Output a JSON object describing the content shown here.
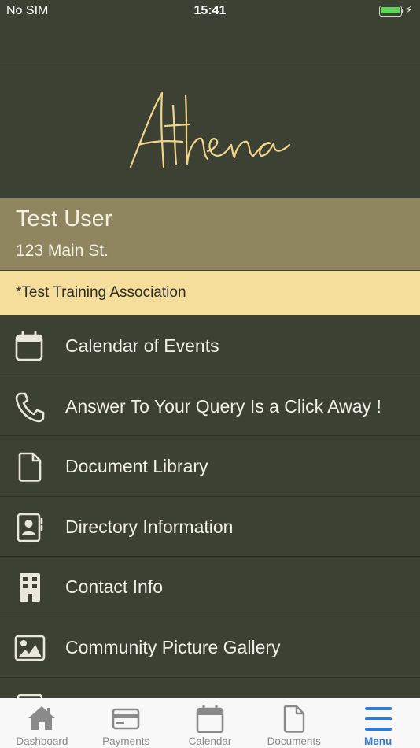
{
  "status_bar": {
    "carrier": "No SIM",
    "time": "15:41"
  },
  "brand": {
    "logo_text": "Athena",
    "logo_color": "#f0d58a"
  },
  "profile": {
    "name": "Test User",
    "address": "123 Main St."
  },
  "association": {
    "name": "*Test Training Association"
  },
  "menu": {
    "items": [
      {
        "label": "Calendar of Events",
        "icon": "calendar-icon"
      },
      {
        "label": "Answer To Your Query Is a Click Away !",
        "icon": "phone-icon"
      },
      {
        "label": "Document Library",
        "icon": "document-icon"
      },
      {
        "label": "Directory Information",
        "icon": "contact-card-icon"
      },
      {
        "label": "Contact Info",
        "icon": "building-icon"
      },
      {
        "label": "Community Picture Gallery",
        "icon": "image-icon"
      }
    ]
  },
  "tab_bar": {
    "tabs": [
      {
        "label": "Dashboard",
        "icon": "home-icon"
      },
      {
        "label": "Payments",
        "icon": "credit-card-icon"
      },
      {
        "label": "Calendar",
        "icon": "calendar-icon"
      },
      {
        "label": "Documents",
        "icon": "document-icon"
      },
      {
        "label": "Menu",
        "icon": "hamburger-icon"
      }
    ],
    "active": "Menu"
  },
  "colors": {
    "background": "#3d4133",
    "profile_band": "#8f8660",
    "association_band": "#f5dd9b",
    "active_tab": "#2f7bd6"
  }
}
